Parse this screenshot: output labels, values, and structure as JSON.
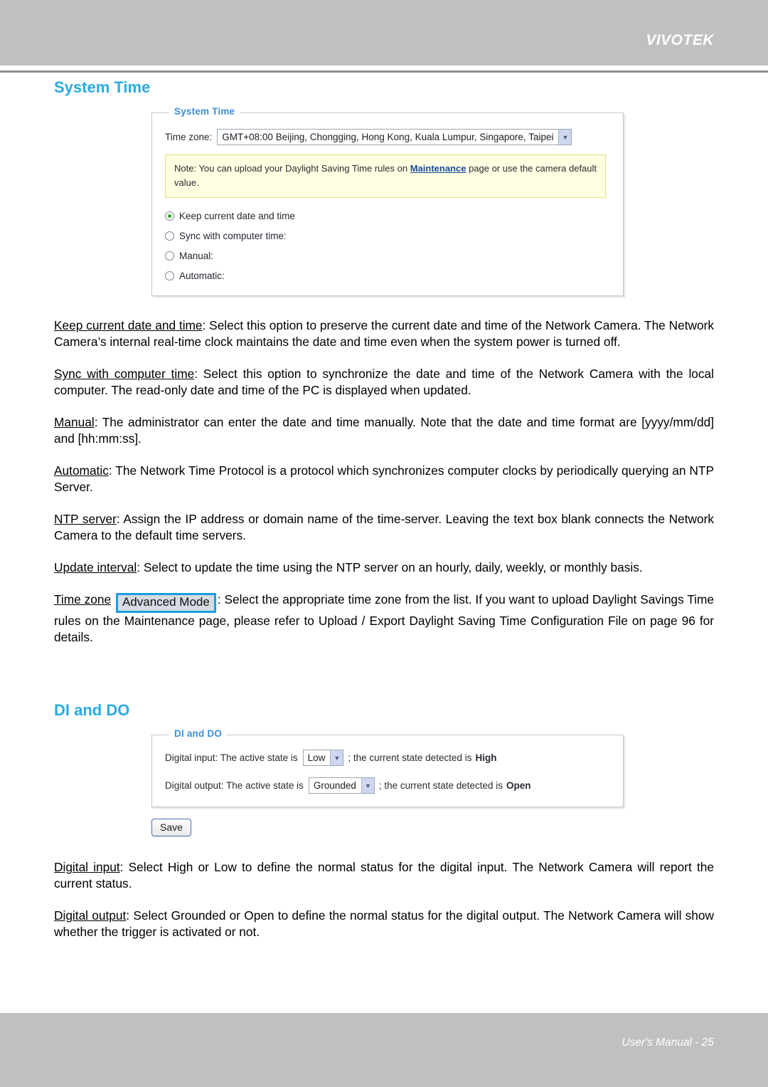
{
  "header": {
    "brand": "VIVOTEK"
  },
  "footer": {
    "text": "User's Manual - 25"
  },
  "colors": {
    "heading_blue": "#29abe2",
    "legend_blue": "#3d8fd6",
    "header_gray": "#bfc1c0",
    "note_yellow_bg": "#ffffe1",
    "note_yellow_border": "#e6db87",
    "link_blue": "#17499c",
    "radio_dot_green": "#2fa81f",
    "badge_border_blue": "#1a9ee0",
    "badge_fill": "#d5dce3"
  },
  "system_time": {
    "heading": "System Time",
    "panel_legend": "System Time",
    "timezone_label": "Time zone:",
    "timezone_value": "GMT+08:00 Beijing, Chongging, Hong Kong, Kuala Lumpur, Singapore, Taipei",
    "dropdown_icon": "chevron-down-icon",
    "note_before_link": "Note: You can upload your Daylight Saving Time rules on ",
    "note_link": "Maintenance",
    "note_after_link": " page or use the camera default value.",
    "options": [
      {
        "label": "Keep current date and time",
        "selected": true
      },
      {
        "label": "Sync with computer time:",
        "selected": false
      },
      {
        "label": "Manual:",
        "selected": false
      },
      {
        "label": "Automatic:",
        "selected": false
      }
    ]
  },
  "paragraphs": {
    "keep_current": {
      "term": "Keep current date and time",
      "body": ": Select this option to preserve the current date and time of the Network Camera. The Network Camera’s internal real-time clock maintains the date and time even when the system power is turned off."
    },
    "sync_with_computer": {
      "term": "Sync with computer time",
      "body": ": Select this option to synchronize the date and time of the Network Camera with the local computer. The read-only date and time of the PC is displayed when updated."
    },
    "manual": {
      "term": "Manual",
      "body": ": The administrator can enter the date and time manually. Note that the date and time format are [yyyy/mm/dd] and [hh:mm:ss]."
    },
    "automatic": {
      "term": "Automatic",
      "body": ": The Network Time Protocol is a protocol which synchronizes computer clocks by periodically querying an NTP Server."
    },
    "ntp_server": {
      "term": "NTP server",
      "body": ": Assign the IP address or domain name of the time-server. Leaving the text box blank connects the Network Camera to the default time servers."
    },
    "update_interval": {
      "term": "Update interval",
      "body": ": Select to update the time using the NTP server on an hourly, daily, weekly, or monthly basis."
    },
    "time_zone": {
      "term": "Time zone",
      "badge": "Advanced Mode",
      "body": ": Select the appropriate time zone from the list. If you want to upload Daylight Savings Time rules on the Maintenance page, please refer to Upload / Export Daylight Saving Time Configuration File on page 96 for details."
    },
    "digital_input_desc": {
      "term": "Digital input",
      "body": ": Select High or Low to define the normal status for the digital input. The Network Camera will report the current status."
    },
    "digital_output_desc": {
      "term": "Digital output",
      "body": ": Select Grounded or Open to define the normal status for the digital output. The Network Camera will show whether the trigger is activated or not."
    }
  },
  "di_do": {
    "heading": "DI and DO",
    "panel_legend": "DI and DO",
    "input_label": "Digital input: The active state is",
    "input_value": "Low",
    "input_mid": "; the current state detected is",
    "input_state": "High",
    "output_label": "Digital output: The active state is",
    "output_value": "Grounded",
    "output_mid": "; the current state detected is",
    "output_state": "Open",
    "save_label": "Save"
  }
}
